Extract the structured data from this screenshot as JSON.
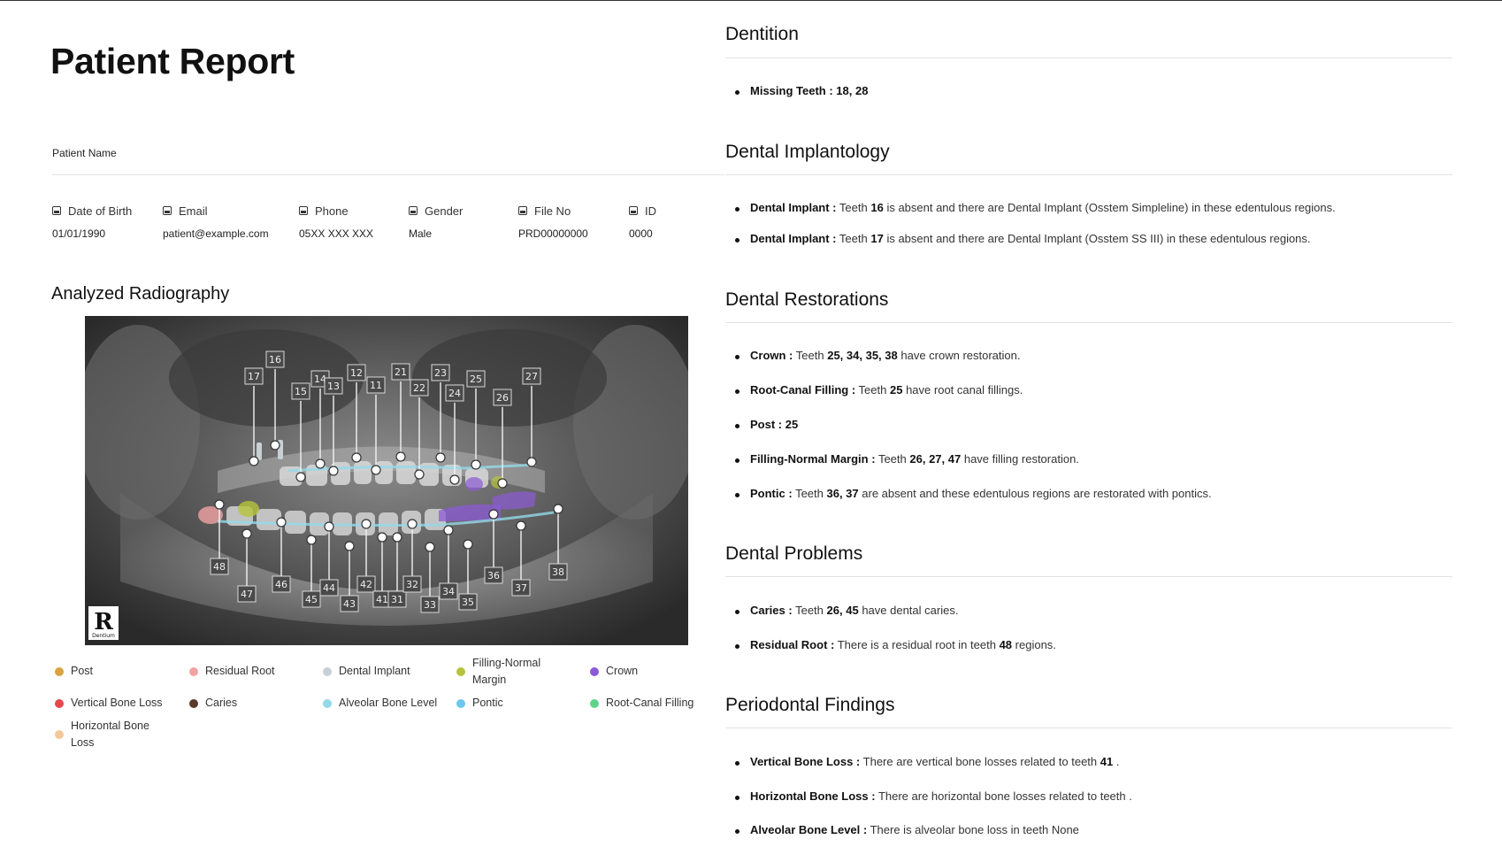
{
  "report": {
    "title": "Patient Report",
    "patient_name_label": "Patient Name"
  },
  "patient_info": [
    {
      "label": "Date of Birth",
      "value": "01/01/1990",
      "icon": "calendar-icon"
    },
    {
      "label": "Email",
      "value": "patient@example.com",
      "icon": "email-icon"
    },
    {
      "label": "Phone",
      "value": "05XX XXX XXX",
      "icon": "phone-icon"
    },
    {
      "label": "Gender",
      "value": "Male",
      "icon": "gender-icon"
    },
    {
      "label": "File No",
      "value": "PRD00000000",
      "icon": "file-icon"
    },
    {
      "label": "ID",
      "value": "0000",
      "icon": "id-icon"
    }
  ],
  "radiography": {
    "title": "Analyzed Radiography",
    "logo_letter": "R",
    "logo_caption": "Dentium",
    "teeth_labels": [
      "16",
      "17",
      "15",
      "14",
      "13",
      "12",
      "11",
      "21",
      "22",
      "23",
      "24",
      "25",
      "26",
      "27",
      "48",
      "47",
      "46",
      "45",
      "44",
      "43",
      "42",
      "41",
      "31",
      "32",
      "33",
      "34",
      "35",
      "36",
      "37",
      "38"
    ]
  },
  "legend": [
    {
      "label": "Post",
      "color": "#d9a441"
    },
    {
      "label": "Residual Root",
      "color": "#f0a3a3"
    },
    {
      "label": "Dental Implant",
      "color": "#c8d0d4"
    },
    {
      "label": "Filling-Normal Margin",
      "color": "#b6c43c"
    },
    {
      "label": "Crown",
      "color": "#8b5bd6"
    },
    {
      "label": "Vertical Bone Loss",
      "color": "#e5484d"
    },
    {
      "label": "Caries",
      "color": "#5a3a2a"
    },
    {
      "label": "Alveolar Bone Level",
      "color": "#93d9e8"
    },
    {
      "label": "Pontic",
      "color": "#6cc7ef"
    },
    {
      "label": "Root-Canal Filling",
      "color": "#5fd38b"
    },
    {
      "label": "Horizontal Bone Loss",
      "color": "#f3c79a"
    }
  ],
  "sections": {
    "dentition": {
      "title": "Dentition",
      "items": [
        {
          "label": "Missing Teeth :",
          "teeth": "18, 28"
        }
      ]
    },
    "implantology": {
      "title": "Dental Implantology",
      "items": [
        {
          "label": "Dental Implant :",
          "pre": "Teeth",
          "teeth": "16",
          "post": "is absent and there are Dental Implant (Osstem Simpleline) in these edentulous regions."
        },
        {
          "label": "Dental Implant :",
          "pre": "Teeth",
          "teeth": "17",
          "post": "is absent and there are Dental Implant (Osstem SS III) in these edentulous regions."
        }
      ]
    },
    "restorations": {
      "title": "Dental Restorations",
      "items": [
        {
          "label": "Crown :",
          "pre": "Teeth",
          "teeth": "25, 34, 35, 38",
          "post": "have crown restoration."
        },
        {
          "label": "Root-Canal Filling :",
          "pre": "Teeth",
          "teeth": "25",
          "post": "have root canal fillings."
        },
        {
          "label": "Post :",
          "teeth": "25"
        },
        {
          "label": "Filling-Normal Margin :",
          "pre": "Teeth",
          "teeth": "26, 27, 47",
          "post": "have filling restoration."
        },
        {
          "label": "Pontic :",
          "pre": "Teeth",
          "teeth": "36, 37",
          "post": "are absent and these edentulous regions are restorated with pontics."
        }
      ]
    },
    "problems": {
      "title": "Dental Problems",
      "items": [
        {
          "label": "Caries :",
          "pre": "Teeth",
          "teeth": "26, 45",
          "post": "have dental caries."
        },
        {
          "label": "Residual Root :",
          "pre": "There is a residual root in teeth",
          "teeth": "48",
          "post": "regions."
        }
      ]
    },
    "periodontal": {
      "title": "Periodontal Findings",
      "items": [
        {
          "label": "Vertical Bone Loss :",
          "pre": "There are vertical bone losses related to teeth",
          "teeth": "41",
          "post": "."
        },
        {
          "label": "Horizontal Bone Loss :",
          "pre": "There are horizontal bone losses related to teeth",
          "post": "."
        },
        {
          "label": "Alveolar Bone Level :",
          "pre": "There is alveolar bone loss in teeth None"
        }
      ]
    }
  }
}
